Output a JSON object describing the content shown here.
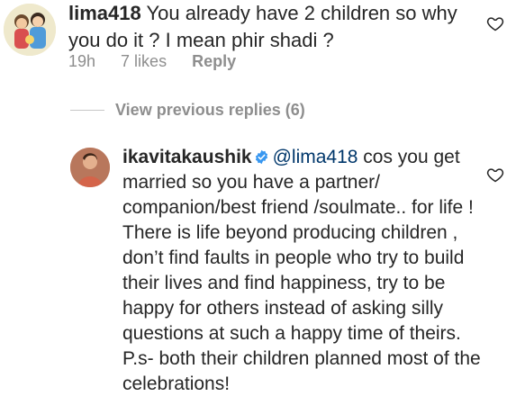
{
  "top_comment": {
    "username": "lima418",
    "text": "You already have 2 children so why you do it ? I mean phir shadi ?",
    "time": "19h",
    "likes": "7 likes",
    "reply_label": "Reply"
  },
  "view_replies": "View previous replies (6)",
  "reply": {
    "username": "ikavitakaushik",
    "mention": "@lima418",
    "text": "cos you get married so you have a partner/ companion/best friend /soulmate.. for life ! There is life beyond producing children , don’t find faults in people who try to build their lives and find happiness, try to be happy for others instead of asking silly questions at such a happy time of theirs.",
    "ps": "P.s- both their children planned most of the celebrations!"
  },
  "icons": {
    "heart": "heart-icon",
    "verified": "verified-badge-icon"
  },
  "colors": {
    "text": "#262626",
    "meta": "#8e8e8e",
    "verified": "#3897f0",
    "mention": "#00376b"
  }
}
